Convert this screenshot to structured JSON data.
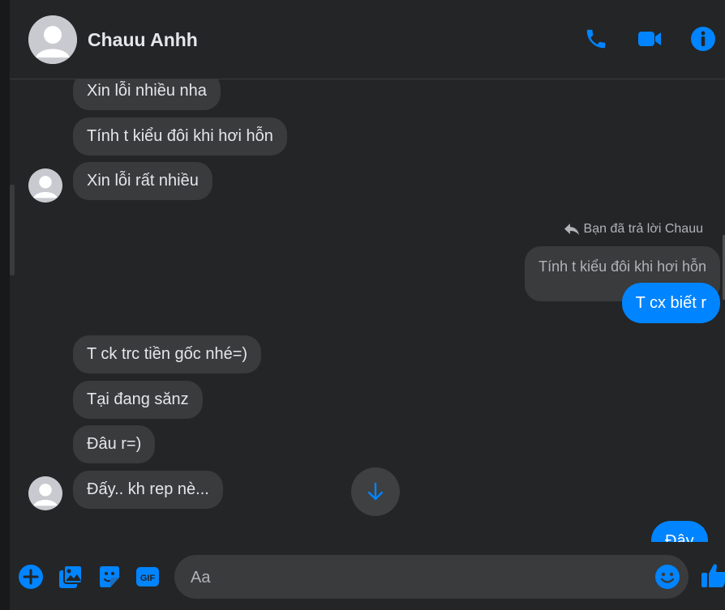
{
  "colors": {
    "accent": "#0084ff",
    "background": "#242526",
    "bubble_incoming": "#3a3b3c",
    "bubble_outgoing": "#0084ff",
    "text": "#e4e6eb",
    "muted_text": "#b0b3b8"
  },
  "header": {
    "contact_name": "Chauu Anhh",
    "icons": [
      "phone-icon",
      "video-camera-icon",
      "info-icon"
    ]
  },
  "messages": {
    "incoming_group_1": [
      "Xin lỗi nhiều nha",
      "Tính t kiểu đôi khi hơi hỗn",
      "Xin lỗi rất nhiều"
    ],
    "reply_note": "Bạn đã trả lời Chauu",
    "quoted_message": "Tính t kiểu đôi khi hơi hỗn",
    "outgoing_reply": "T cx biết r",
    "incoming_group_2": [
      "T ck trc tiền gốc nhé=)",
      "Tại đang sănz",
      "Đâu r=)",
      "Đấy.. kh rep nè..."
    ],
    "outgoing_partial": "Đây"
  },
  "composer": {
    "placeholder": "Aa",
    "icons": [
      "add-circle-icon",
      "photo-gallery-icon",
      "sticker-icon",
      "gif-icon",
      "emoji-icon",
      "thumbs-up-icon"
    ]
  }
}
